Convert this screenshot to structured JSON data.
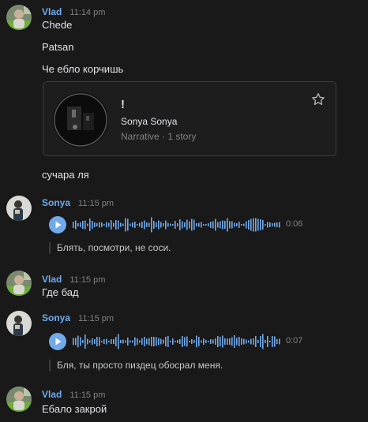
{
  "messages": [
    {
      "author": "Vlad",
      "time": "11:14 pm",
      "lines": [
        "Chede",
        "Patsan",
        "Че ебло корчишь"
      ],
      "story_card": {
        "title": "!",
        "name": "Sonya Sonya",
        "subtitle": "Narrative · 1 story",
        "icon": "star-outline-icon"
      },
      "after": "сучара ля"
    },
    {
      "author": "Sonya",
      "time": "11:15 pm",
      "voice": {
        "duration": "0:06",
        "progress": 0
      },
      "transcript": "Блять, посмотри, не соси."
    },
    {
      "author": "Vlad",
      "time": "11:15 pm",
      "text": "Где бад"
    },
    {
      "author": "Sonya",
      "time": "11:15 pm",
      "voice": {
        "duration": "0:07",
        "progress": 0
      },
      "transcript": "Бля, ты просто пиздец обосрал меня."
    },
    {
      "author": "Vlad",
      "time": "11:15 pm",
      "text": "Ебало закрой"
    }
  ],
  "colors": {
    "background": "#19191a",
    "author": "#71aaeb",
    "accent": "#71aaeb",
    "muted": "#828282"
  }
}
